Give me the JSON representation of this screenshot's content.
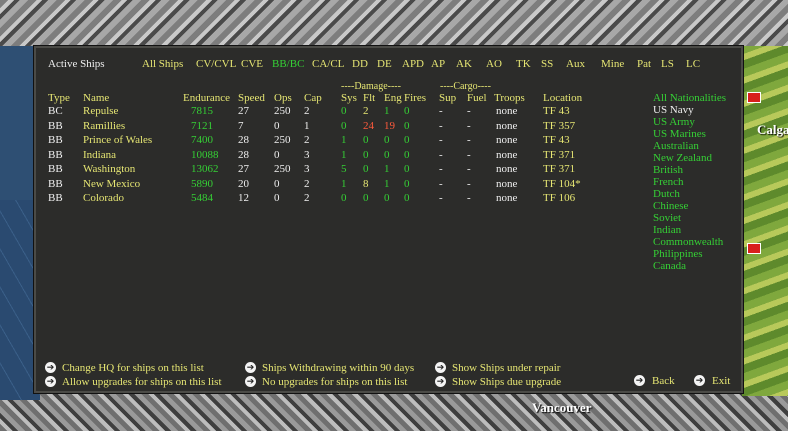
{
  "map": {
    "city_1": "Calga",
    "city_2": "Vancouver"
  },
  "title": "Active Ships",
  "filters": [
    {
      "label": "All Ships",
      "active": false
    },
    {
      "label": "CV/CVL",
      "active": false
    },
    {
      "label": "CVE",
      "active": false
    },
    {
      "label": "BB/BC",
      "active": true
    },
    {
      "label": "CA/CL",
      "active": false
    },
    {
      "label": "DD",
      "active": false
    },
    {
      "label": "DE",
      "active": false
    },
    {
      "label": "APD",
      "active": false
    },
    {
      "label": "AP",
      "active": false
    },
    {
      "label": "AK",
      "active": false
    },
    {
      "label": "AO",
      "active": false
    },
    {
      "label": "TK",
      "active": false
    },
    {
      "label": "SS",
      "active": false
    },
    {
      "label": "Aux",
      "active": false
    },
    {
      "label": "Mine",
      "active": false
    },
    {
      "label": "Pat",
      "active": false
    },
    {
      "label": "LS",
      "active": false
    },
    {
      "label": "LC",
      "active": false
    }
  ],
  "group_headers": {
    "damage": "----Damage----",
    "cargo": "----Cargo----"
  },
  "columns": {
    "type": "Type",
    "name": "Name",
    "endurance": "Endurance",
    "speed": "Speed",
    "ops": "Ops",
    "cap": "Cap",
    "sys": "Sys",
    "flt": "Flt",
    "eng": "Eng",
    "fires": "Fires",
    "sup": "Sup",
    "fuel": "Fuel",
    "troops": "Troops",
    "location": "Location"
  },
  "ships": [
    {
      "type": "BC",
      "name": "Repulse",
      "endurance": "7815",
      "speed": "27",
      "ops": "250",
      "cap": "2",
      "sys": "0",
      "flt": "2",
      "eng": "1",
      "fires": "0",
      "sup": "-",
      "fuel": "-",
      "troops": "none",
      "location": "TF 43"
    },
    {
      "type": "BB",
      "name": "Ramillies",
      "endurance": "7121",
      "speed": "7",
      "ops": "0",
      "cap": "1",
      "sys": "0",
      "flt": "24",
      "eng": "19",
      "fires": "0",
      "sup": "-",
      "fuel": "-",
      "troops": "none",
      "location": "TF 357"
    },
    {
      "type": "BB",
      "name": "Prince of Wales",
      "endurance": "7400",
      "speed": "28",
      "ops": "250",
      "cap": "2",
      "sys": "1",
      "flt": "0",
      "eng": "0",
      "fires": "0",
      "sup": "-",
      "fuel": "-",
      "troops": "none",
      "location": "TF 43"
    },
    {
      "type": "BB",
      "name": "Indiana",
      "endurance": "10088",
      "speed": "28",
      "ops": "0",
      "cap": "3",
      "sys": "1",
      "flt": "0",
      "eng": "0",
      "fires": "0",
      "sup": "-",
      "fuel": "-",
      "troops": "none",
      "location": "TF 371"
    },
    {
      "type": "BB",
      "name": "Washington",
      "endurance": "13062",
      "speed": "27",
      "ops": "250",
      "cap": "3",
      "sys": "5",
      "flt": "0",
      "eng": "1",
      "fires": "0",
      "sup": "-",
      "fuel": "-",
      "troops": "none",
      "location": "TF 371"
    },
    {
      "type": "BB",
      "name": "New Mexico",
      "endurance": "5890",
      "speed": "20",
      "ops": "0",
      "cap": "2",
      "sys": "1",
      "flt": "8",
      "eng": "1",
      "fires": "0",
      "sup": "-",
      "fuel": "-",
      "troops": "none",
      "location": "TF 104*"
    },
    {
      "type": "BB",
      "name": "Colorado",
      "endurance": "5484",
      "speed": "12",
      "ops": "0",
      "cap": "2",
      "sys": "0",
      "flt": "0",
      "eng": "0",
      "fires": "0",
      "sup": "-",
      "fuel": "-",
      "troops": "none",
      "location": "TF 106"
    }
  ],
  "colors": {
    "yellow": "#e6e673",
    "green": "#35d035",
    "red": "#ff5a3c",
    "white": "#f0f0f0"
  },
  "nationalities": [
    {
      "label": "All Nationalities",
      "selected": false
    },
    {
      "label": "US Navy",
      "selected": true
    },
    {
      "label": "US Army",
      "selected": false
    },
    {
      "label": "US Marines",
      "selected": false
    },
    {
      "label": "Australian",
      "selected": false
    },
    {
      "label": "New Zealand",
      "selected": false
    },
    {
      "label": "British",
      "selected": false
    },
    {
      "label": "French",
      "selected": false
    },
    {
      "label": "Dutch",
      "selected": false
    },
    {
      "label": "Chinese",
      "selected": false
    },
    {
      "label": "Soviet",
      "selected": false
    },
    {
      "label": "Indian",
      "selected": false
    },
    {
      "label": "Commonwealth",
      "selected": false
    },
    {
      "label": "Philippines",
      "selected": false
    },
    {
      "label": "Canada",
      "selected": false
    }
  ],
  "commands": {
    "change_hq": "Change HQ for ships on this list",
    "allow_upgrades": "Allow upgrades for ships on this list",
    "withdrawing": "Ships Withdrawing within 90 days",
    "no_upgrades": "No upgrades for ships on this list",
    "under_repair": "Show Ships under repair",
    "due_upgrade": "Show Ships due upgrade",
    "back": "Back",
    "exit": "Exit"
  }
}
